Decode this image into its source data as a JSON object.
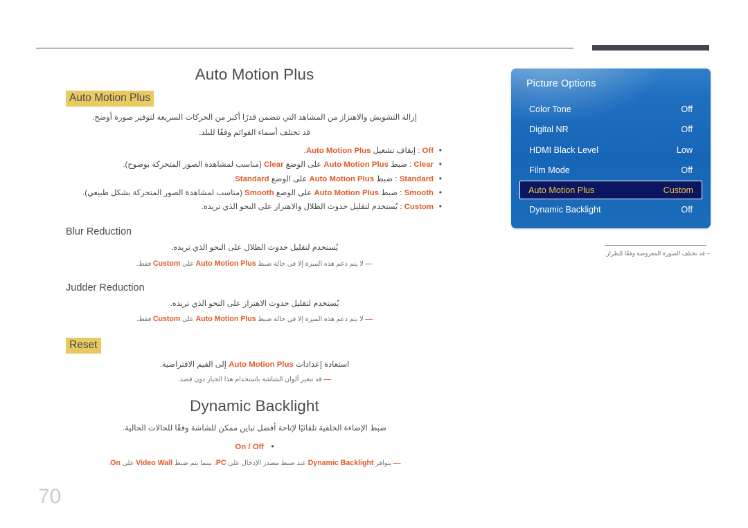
{
  "page": {
    "number": "70"
  },
  "content": {
    "title": "Auto Motion Plus",
    "auto_motion_plus": {
      "heading": "Auto Motion Plus",
      "intro_line1": "إزالة التشويش والاهتزاز من المشاهد التي تتضمن قدرًا أكبر من الحركات السريعة لتوفير صورة أوضح.",
      "intro_line2": "قد تختلف أسماء القوائم وفقًا للبلد.",
      "bullets": [
        {
          "key": "Off",
          "segments": [
            {
              "t": "Off",
              "kw": true
            },
            {
              "t": " : إيقاف تشغيل ",
              "kw": false
            },
            {
              "t": "Auto Motion Plus",
              "kw": true
            },
            {
              "t": ".",
              "kw": false
            }
          ]
        },
        {
          "key": "Clear",
          "segments": [
            {
              "t": "Clear",
              "kw": true
            },
            {
              "t": " : ضبط ",
              "kw": false
            },
            {
              "t": "Auto Motion Plus",
              "kw": true
            },
            {
              "t": " على الوضع ",
              "kw": false
            },
            {
              "t": "Clear",
              "kw": true
            },
            {
              "t": " (مناسب لمشاهدة الصور المتحركة بوضوح).",
              "kw": false
            }
          ]
        },
        {
          "key": "Standard",
          "segments": [
            {
              "t": "Standard",
              "kw": true
            },
            {
              "t": " : ضبط ",
              "kw": false
            },
            {
              "t": "Auto Motion Plus",
              "kw": true
            },
            {
              "t": " على الوضع ",
              "kw": false
            },
            {
              "t": "Standard",
              "kw": true
            },
            {
              "t": ".",
              "kw": false
            }
          ]
        },
        {
          "key": "Smooth",
          "segments": [
            {
              "t": "Smooth",
              "kw": true
            },
            {
              "t": " : ضبط ",
              "kw": false
            },
            {
              "t": "Auto Motion Plus",
              "kw": true
            },
            {
              "t": " على الوضع ",
              "kw": false
            },
            {
              "t": "Smooth",
              "kw": true
            },
            {
              "t": " (مناسب لمشاهدة الصور المتحركة بشكل طبيعي).",
              "kw": false
            }
          ]
        },
        {
          "key": "Custom",
          "segments": [
            {
              "t": "Custom",
              "kw": true
            },
            {
              "t": " : يُستخدم لتقليل حدوث الظلال والاهتزاز على النحو الذي تريده.",
              "kw": false
            }
          ]
        }
      ]
    },
    "blur_reduction": {
      "heading": "Blur Reduction",
      "body": "يُستخدم لتقليل حدوث الظلال على النحو الذي تريده.",
      "note": [
        {
          "t": "لا يتم دعم هذه الميزة إلا في حالة ضبط ",
          "kw": false
        },
        {
          "t": "Auto Motion Plus",
          "kw": true
        },
        {
          "t": " على ",
          "kw": false
        },
        {
          "t": "Custom",
          "kw": true
        },
        {
          "t": " فقط.",
          "kw": false
        }
      ]
    },
    "judder_reduction": {
      "heading": "Judder Reduction",
      "body": "يُستخدم لتقليل حدوث الاهتزاز على النحو الذي تريده.",
      "note": [
        {
          "t": "لا يتم دعم هذه الميزة إلا في حالة ضبط ",
          "kw": false
        },
        {
          "t": "Auto Motion Plus",
          "kw": true
        },
        {
          "t": " على ",
          "kw": false
        },
        {
          "t": "Custom",
          "kw": true
        },
        {
          "t": " فقط.",
          "kw": false
        }
      ]
    },
    "reset": {
      "heading": "Reset",
      "body": [
        {
          "t": "استعادة إعدادات ",
          "kw": false
        },
        {
          "t": "Auto Motion Plus",
          "kw": true
        },
        {
          "t": " إلى القيم الافتراضية.",
          "kw": false
        }
      ],
      "note": [
        {
          "t": "قد تتغير ألوان الشاشة باستخدام هذا الخيار دون قصد.",
          "kw": false
        }
      ]
    },
    "dynamic_backlight": {
      "heading": "Dynamic Backlight",
      "body": "ضبط الإضاءة الخلفية تلقائيًا لإتاحة أفضل تباين ممكن للشاشة وفقًا للحالات الحالية.",
      "bullet": "On / Off",
      "note": [
        {
          "t": "يتوافر ",
          "kw": false
        },
        {
          "t": "Dynamic Backlight",
          "kw": true
        },
        {
          "t": " عند ضبط مصدر الإدخال على ",
          "kw": false
        },
        {
          "t": "PC",
          "kw": true
        },
        {
          "t": "، بينما يتم ضبط ",
          "kw": false
        },
        {
          "t": "Video Wall",
          "kw": true
        },
        {
          "t": " على ",
          "kw": false
        },
        {
          "t": "On",
          "kw": true
        },
        {
          "t": ".",
          "kw": false
        }
      ]
    }
  },
  "osd": {
    "title": "Picture Options",
    "rows": [
      {
        "label": "Color Tone",
        "value": "Off",
        "selected": false
      },
      {
        "label": "Digital NR",
        "value": "Off",
        "selected": false
      },
      {
        "label": "HDMI Black Level",
        "value": "Low",
        "selected": false
      },
      {
        "label": "Film Mode",
        "value": "Off",
        "selected": false
      },
      {
        "label": "Auto Motion Plus",
        "value": "Custom",
        "selected": true
      },
      {
        "label": "Dynamic Backlight",
        "value": "Off",
        "selected": false
      }
    ],
    "note": "قد تختلف الصورة المعروضة وفقًا للطراز."
  },
  "colors": {
    "keyword": "#e05a28",
    "highlight": "#e9c961",
    "osd_selected_bg": "#0b1560",
    "osd_selected_text": "#f0c33c",
    "osd_blue": "#1f6fc0"
  }
}
